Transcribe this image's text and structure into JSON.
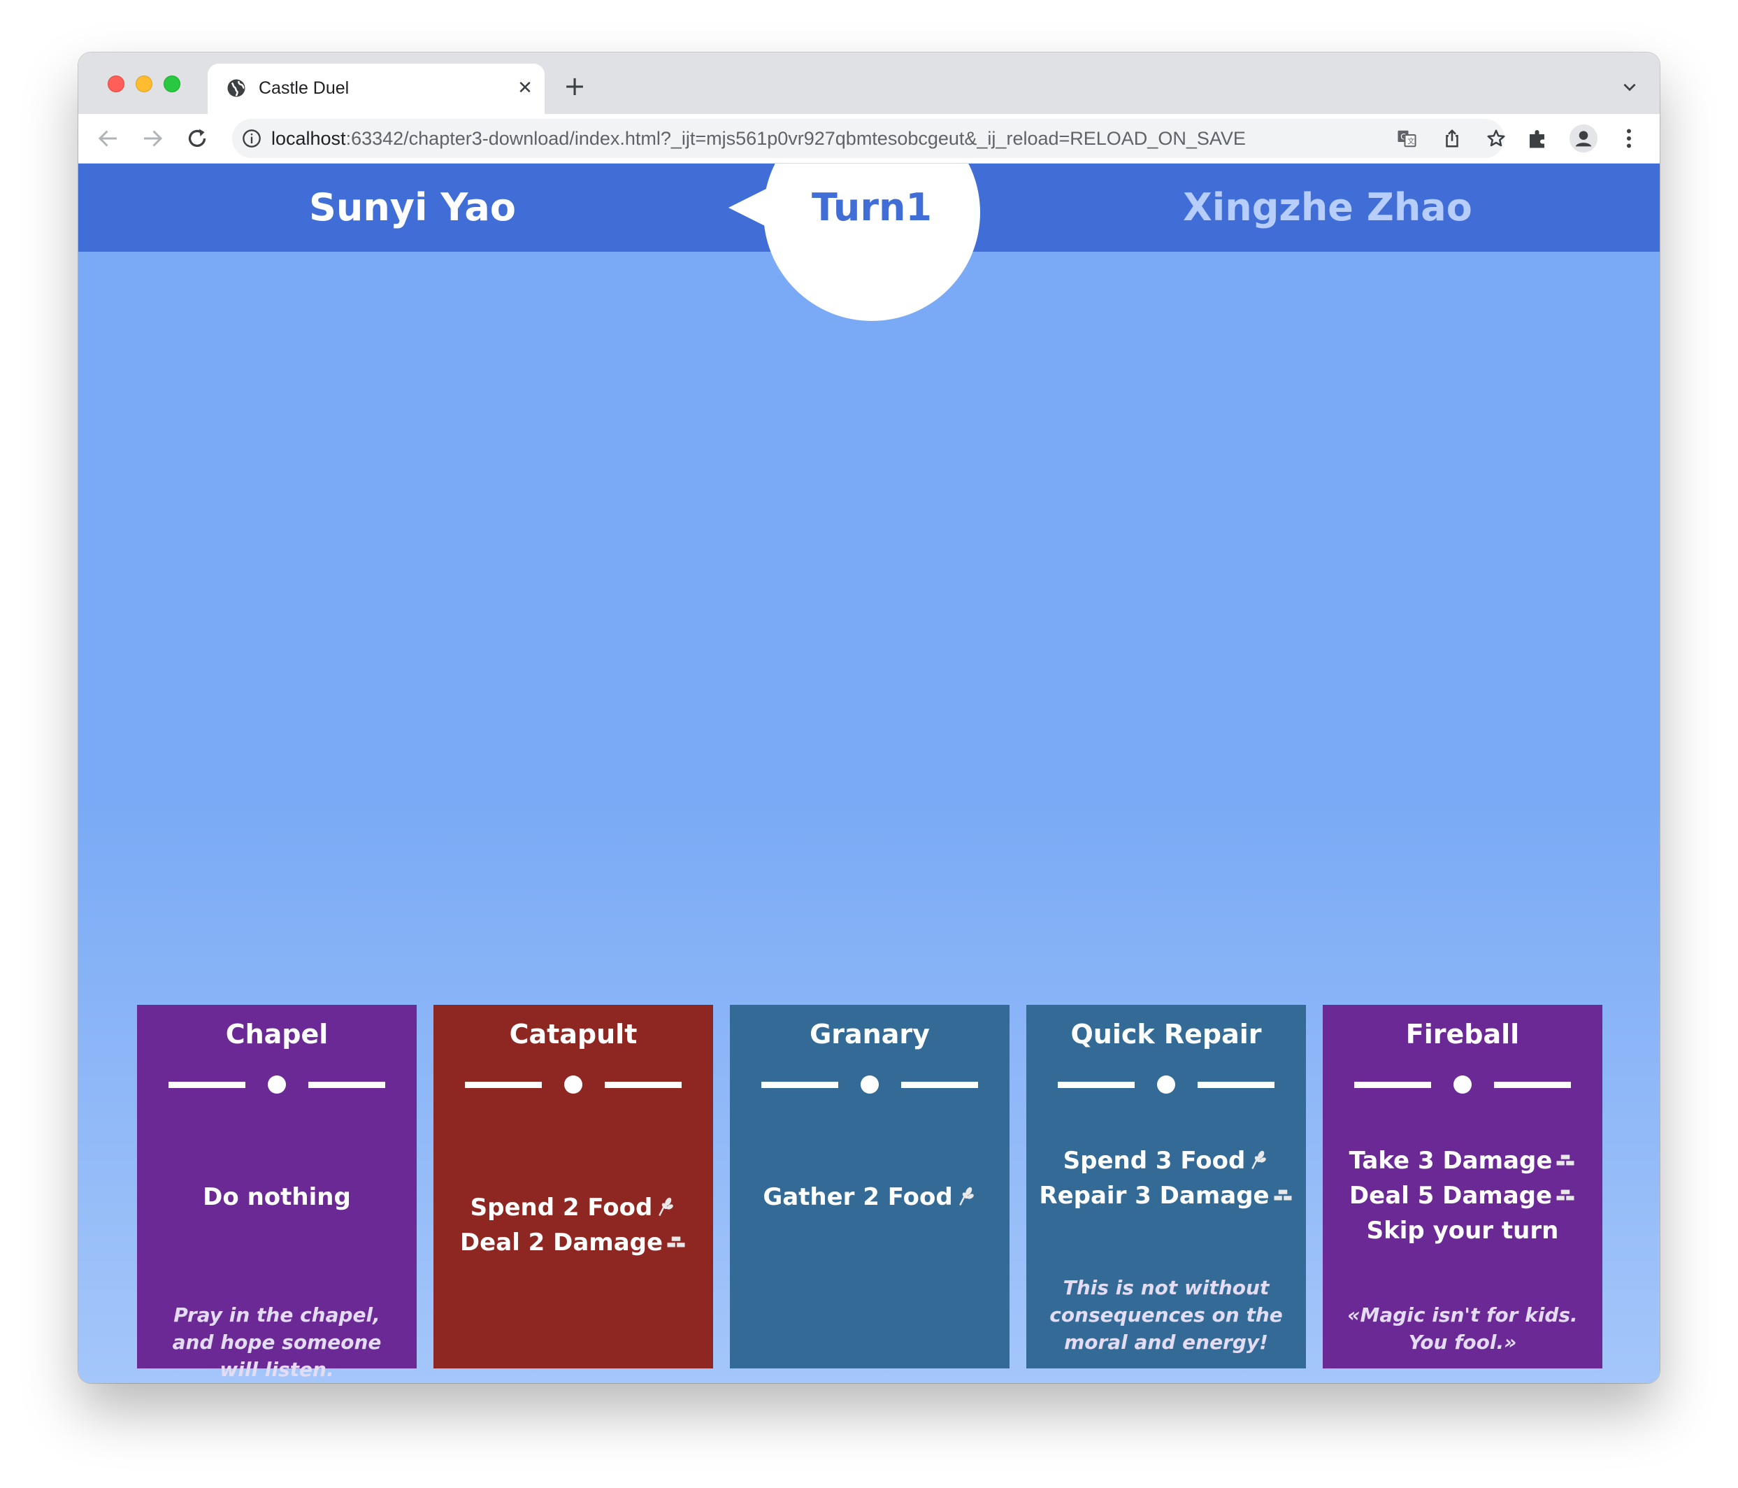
{
  "browser": {
    "tab_title": "Castle Duel",
    "tab_close_glyph": "✕",
    "new_tab_glyph": "+",
    "url_host": "localhost",
    "url_rest": ":63342/chapter3-download/index.html?_ijt=mjs561p0vr927qbmtesobcgeut&_ij_reload=RELOAD_ON_SAVE",
    "icons": [
      "globe-icon",
      "close-icon",
      "plus-icon",
      "chevron-down-icon",
      "back-icon",
      "forward-icon",
      "reload-icon",
      "info-icon",
      "translate-icon",
      "share-icon",
      "star-icon",
      "extensions-icon",
      "profile-icon",
      "menu-icon"
    ]
  },
  "game": {
    "player1": "Sunyi Yao",
    "player2": "Xingzhe Zhao",
    "turn": "Turn1",
    "colors": {
      "topbar": "#416ed6",
      "background": "#7aaaf5",
      "player2_name": "#b7cdfa"
    }
  },
  "cards": [
    {
      "title": "Chapel",
      "color": "#6a2995",
      "lines": [
        {
          "text": "Do nothing"
        }
      ],
      "flavor": "Pray in the chapel, and hope someone will listen."
    },
    {
      "title": "Catapult",
      "color": "#8e2622",
      "lines": [
        {
          "text": "Spend 2 Food",
          "icon": "food-icon"
        },
        {
          "text": "Deal 2 Damage",
          "icon": "damage-icon"
        }
      ],
      "flavor": ""
    },
    {
      "title": "Granary",
      "color": "#336b96",
      "lines": [
        {
          "text": "Gather 2 Food",
          "icon": "food-icon"
        }
      ],
      "flavor": ""
    },
    {
      "title": "Quick Repair",
      "color": "#336b96",
      "lines": [
        {
          "text": "Spend 3 Food",
          "icon": "food-icon"
        },
        {
          "text": "Repair 3 Damage",
          "icon": "damage-icon"
        }
      ],
      "flavor": "This is not without consequences on the moral and energy!"
    },
    {
      "title": "Fireball",
      "color": "#6a2995",
      "lines": [
        {
          "text": "Take 3 Damage",
          "icon": "damage-icon"
        },
        {
          "text": "Deal 5 Damage",
          "icon": "damage-icon"
        },
        {
          "text": "Skip your turn"
        }
      ],
      "flavor": "«Magic isn't for kids. You fool.»"
    }
  ]
}
